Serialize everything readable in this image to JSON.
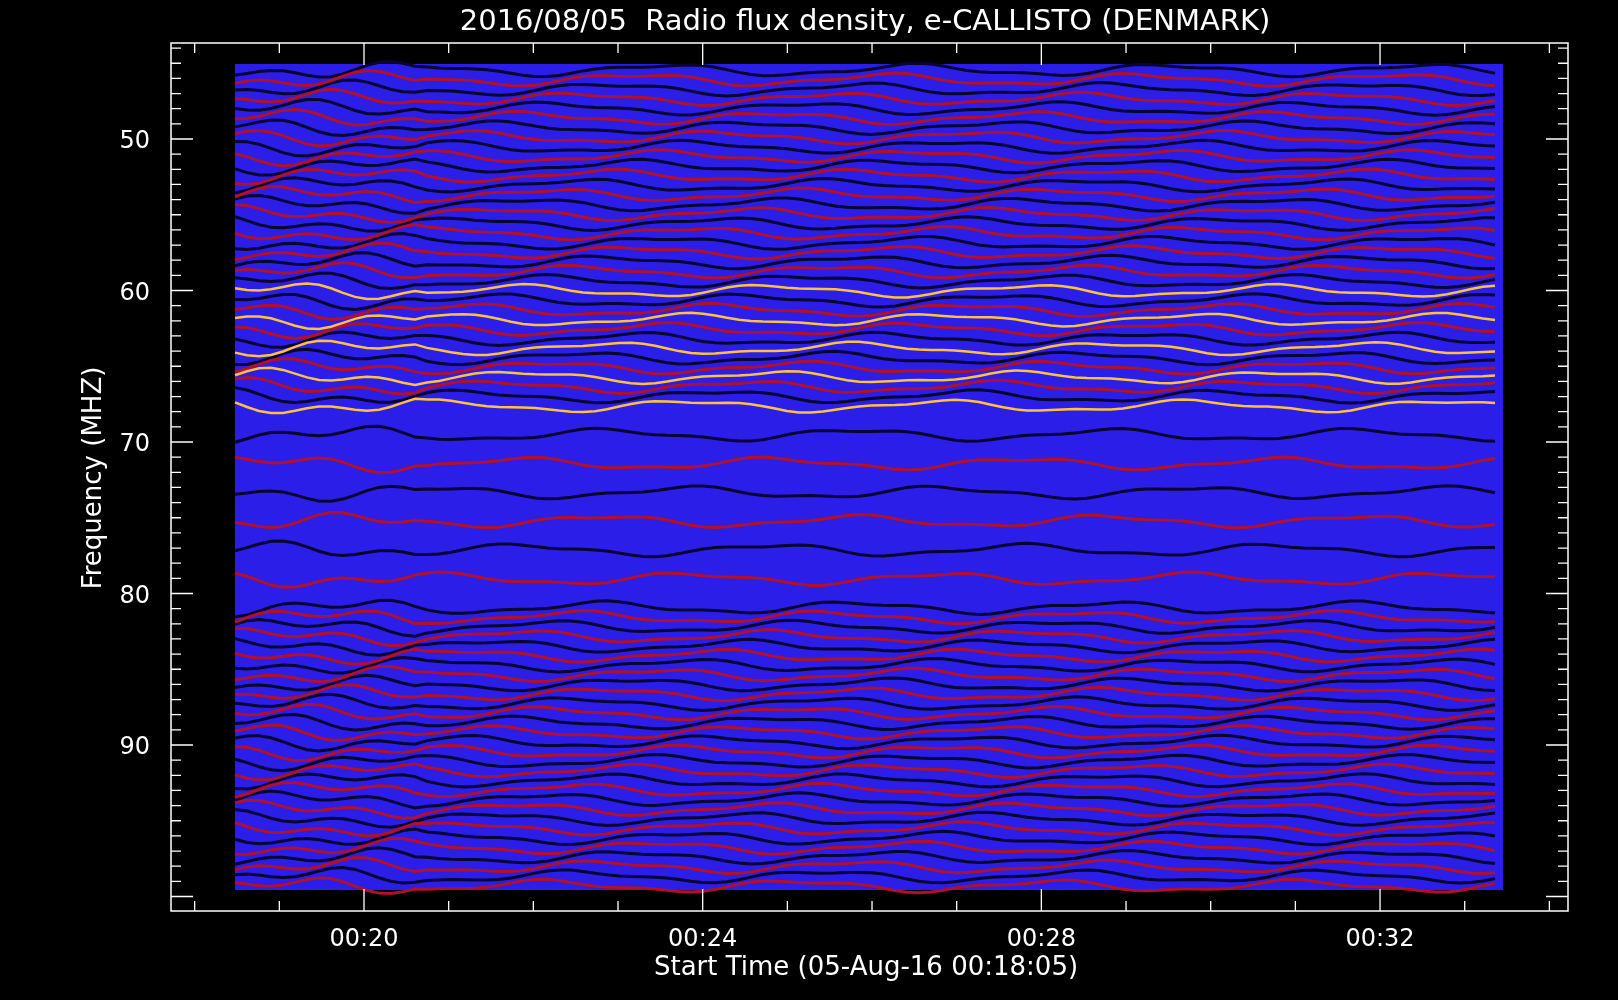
{
  "title": "2016/08/05  Radio flux density, e-CALLISTO (DENMARK)",
  "ylabel": "Frequency (MHZ)",
  "xlabel": "Start Time (05-Aug-16 00:18:05)",
  "yticks": [
    "50",
    "60",
    "70",
    "80",
    "90"
  ],
  "xticks": [
    "00:20",
    "00:24",
    "00:28",
    "00:32"
  ]
}
